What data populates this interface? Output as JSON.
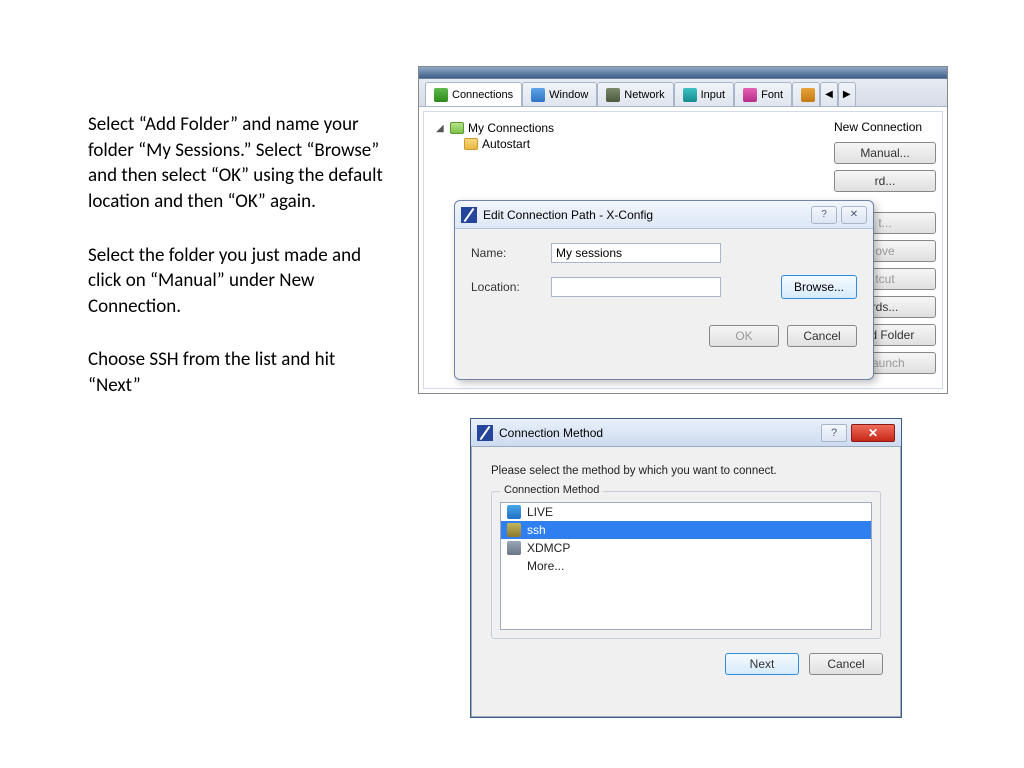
{
  "instructions": {
    "p1": "Select “Add Folder” and name your folder “My Sessions.” Select “Browse” and then select “OK” using the default location and then “OK” again.",
    "p2": "Select the folder you just made and click on “Manual” under New Connection.",
    "p3": "Choose SSH from the list and hit “Next”"
  },
  "xconfig": {
    "tabs": {
      "connections": "Connections",
      "window": "Window",
      "network": "Network",
      "input": "Input",
      "font": "Font"
    },
    "tree": {
      "root": "My Connections",
      "child": "Autostart"
    },
    "side": {
      "heading": "New Connection",
      "manual": "Manual...",
      "wizard": "rd...",
      "edit": "t...",
      "remove": "ove",
      "shortcut": "tcut",
      "passwords": "rds...",
      "addfolder": "Add Folder",
      "launch": "Launch"
    },
    "dialog": {
      "title": "Edit Connection Path - X-Config",
      "name_label": "Name:",
      "name_value": "My sessions",
      "location_label": "Location:",
      "location_value": "",
      "browse": "Browse...",
      "ok": "OK",
      "cancel": "Cancel"
    }
  },
  "connmethod": {
    "title": "Connection Method",
    "prompt": "Please select the method by which you want to connect.",
    "group": "Connection Method",
    "items": {
      "live": "LIVE",
      "ssh": "ssh",
      "xdmcp": "XDMCP",
      "more": "More..."
    },
    "next": "Next",
    "cancel": "Cancel"
  }
}
